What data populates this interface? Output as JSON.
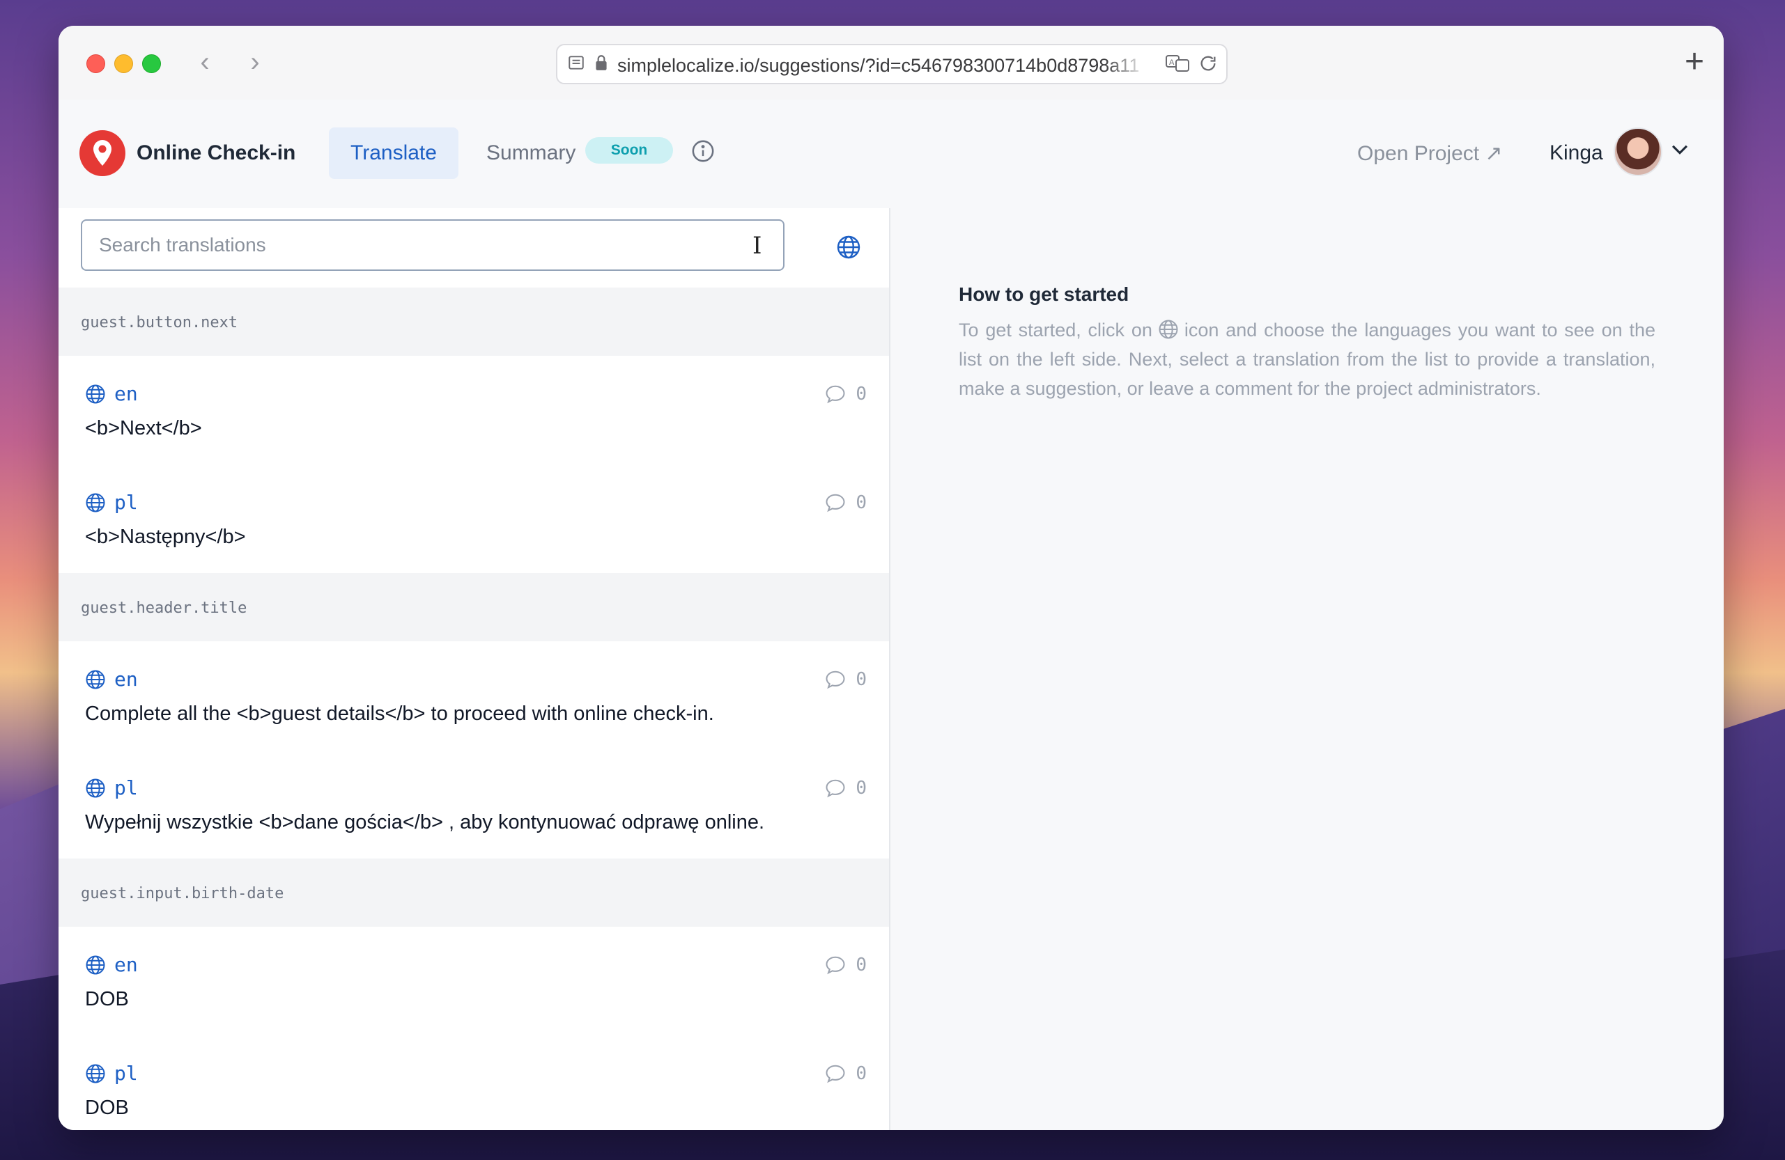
{
  "browser": {
    "url": "simplelocalize.io/suggestions/?id=c546798300714b0d8798a11"
  },
  "app": {
    "name": "Online Check-in",
    "tabs": {
      "translate": "Translate",
      "summary": "Summary",
      "summary_badge": "Soon"
    },
    "open_project": "Open Project ↗",
    "user": "Kinga"
  },
  "search": {
    "placeholder": "Search translations"
  },
  "groups": [
    {
      "key": "guest.button.next",
      "entries": [
        {
          "lang": "en",
          "text": "<b>Next</b>",
          "comments": "0"
        },
        {
          "lang": "pl",
          "text": "<b>Następny</b>",
          "comments": "0"
        }
      ]
    },
    {
      "key": "guest.header.title",
      "entries": [
        {
          "lang": "en",
          "text": "Complete all the <b>guest details</b> to proceed with online check-in.",
          "comments": "0"
        },
        {
          "lang": "pl",
          "text": "Wypełnij wszystkie <b>dane gościa</b> , aby kontynuować odprawę online.",
          "comments": "0"
        }
      ]
    },
    {
      "key": "guest.input.birth-date",
      "entries": [
        {
          "lang": "en",
          "text": "DOB",
          "comments": "0"
        },
        {
          "lang": "pl",
          "text": "DOB",
          "comments": "0"
        }
      ]
    }
  ],
  "help": {
    "title": "How to get started",
    "text_before": "To get started, click on",
    "text_after": "icon and choose the languages you want to see on the list on the left side. Next, select a translation from the list to provide a translation, make a suggestion, or leave a comment for the project administrators."
  },
  "icons": {
    "browser": [
      "sidebar-icon",
      "lock-icon",
      "translate-icon",
      "reload-icon",
      "back-icon",
      "forward-icon",
      "new-tab-icon"
    ],
    "app": [
      "logo-pin-icon",
      "info-icon",
      "globe-icon",
      "comment-icon",
      "chevron-down-icon",
      "external-link-icon"
    ]
  },
  "colors": {
    "accent": "#1d5fc4",
    "badge_bg": "#cdf1f4",
    "badge_text": "#0e9fae",
    "logo": "#e53935"
  }
}
